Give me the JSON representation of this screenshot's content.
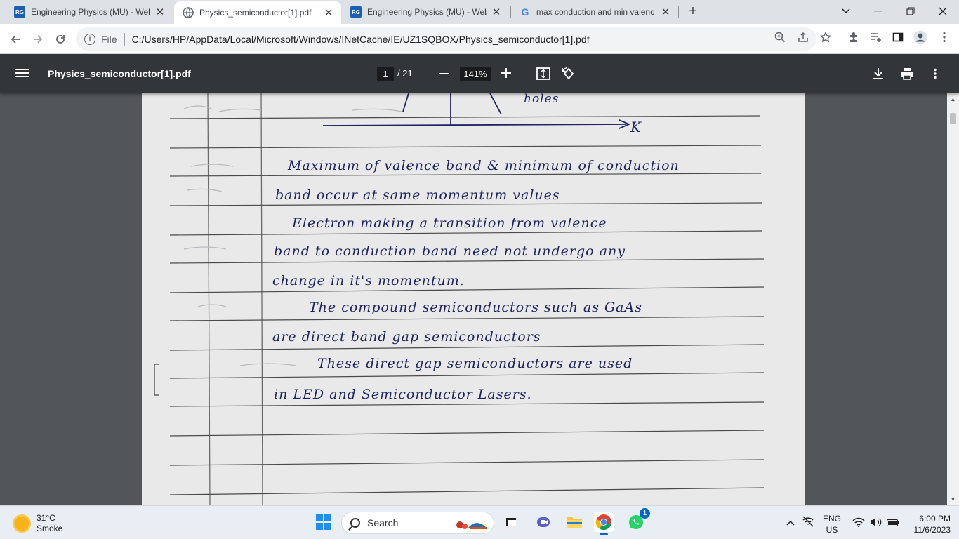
{
  "browser": {
    "tabs": [
      {
        "title": "Engineering Physics (MU) - Web",
        "icon": "researchgate-icon",
        "active": false
      },
      {
        "title": "Physics_semiconductor[1].pdf",
        "icon": "globe-icon",
        "active": true
      },
      {
        "title": "Engineering Physics (MU) - Web",
        "icon": "researchgate-icon",
        "active": false
      },
      {
        "title": "max conduction and min valenc",
        "icon": "google-icon",
        "active": false
      }
    ],
    "favicon_rg": "RG",
    "favicon_g": "G",
    "address": {
      "scheme_label": "File",
      "url": "C:/Users/HP/AppData/Local/Microsoft/Windows/INetCache/IE/UZ1SQBOX/Physics_semiconductor[1].pdf"
    }
  },
  "pdf_viewer": {
    "file_name": "Physics_semiconductor[1].pdf",
    "current_page": "1",
    "total_pages": "/ 21",
    "zoom": "141%"
  },
  "document": {
    "handwritten_lines": [
      "holes",
      "K",
      "Maximum of valence band & minimum of conduction",
      "band occur at same momentum values",
      "Electron making a transition from valence",
      "band to conduction band need not undergo any",
      "change in it's momentum.",
      "The compound semiconductors such as GaAs",
      "are direct band gap semiconductors",
      "These direct gap semiconductors are used",
      "in LED and Semiconductor Lasers."
    ]
  },
  "taskbar": {
    "weather": {
      "temp": "31°C",
      "condition": "Smoke"
    },
    "search_label": "Search",
    "language": {
      "primary": "ENG",
      "secondary": "US"
    },
    "clock": {
      "time": "6:00 PM",
      "date": "11/6/2023"
    },
    "whatsapp_badge": "1"
  },
  "colors": {
    "ink": "#1f2460",
    "paper": "#e9e9ea",
    "pdf_toolbar": "#323639",
    "viewer_bg": "#525659"
  }
}
